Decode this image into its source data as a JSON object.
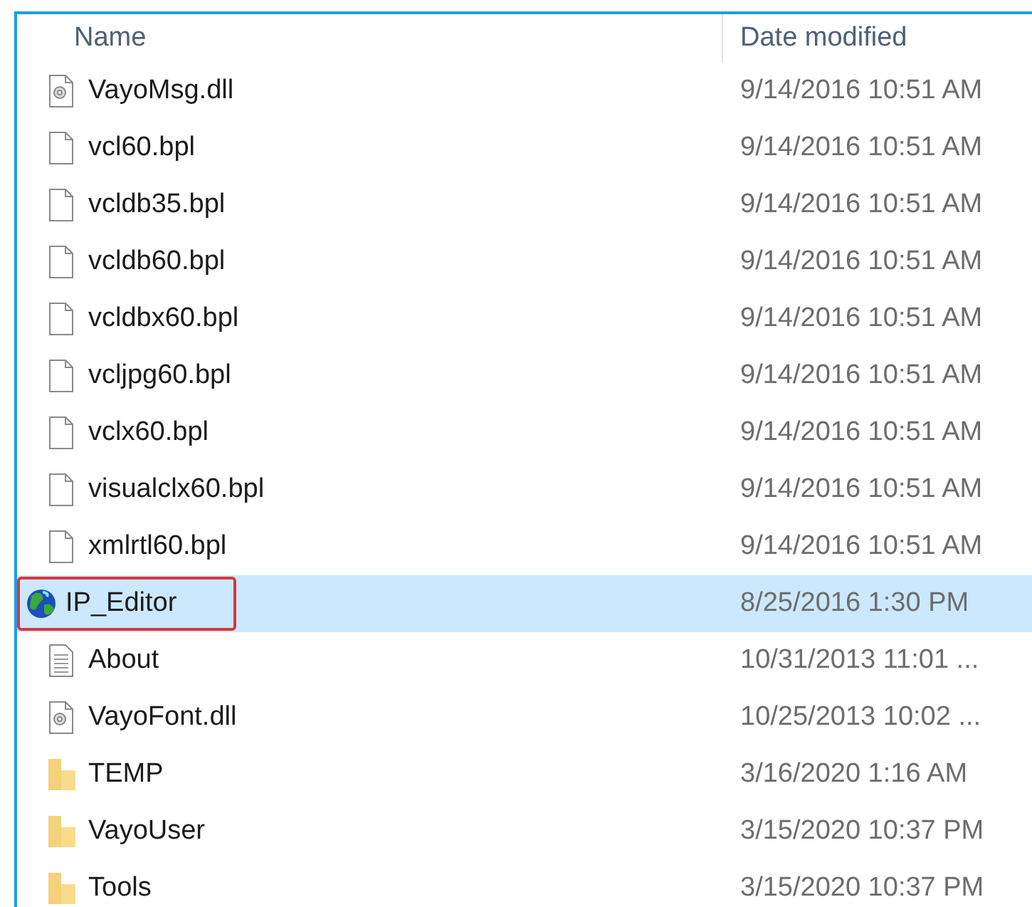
{
  "columns": [
    "Name",
    "Date modified"
  ],
  "files": [
    {
      "kind": "dll",
      "name": "VayoMsg.dll",
      "date": "9/14/2016 10:51 AM",
      "selected": false,
      "outlined": false
    },
    {
      "kind": "file",
      "name": "vcl60.bpl",
      "date": "9/14/2016 10:51 AM",
      "selected": false,
      "outlined": false
    },
    {
      "kind": "file",
      "name": "vcldb35.bpl",
      "date": "9/14/2016 10:51 AM",
      "selected": false,
      "outlined": false
    },
    {
      "kind": "file",
      "name": "vcldb60.bpl",
      "date": "9/14/2016 10:51 AM",
      "selected": false,
      "outlined": false
    },
    {
      "kind": "file",
      "name": "vcldbx60.bpl",
      "date": "9/14/2016 10:51 AM",
      "selected": false,
      "outlined": false
    },
    {
      "kind": "file",
      "name": "vcljpg60.bpl",
      "date": "9/14/2016 10:51 AM",
      "selected": false,
      "outlined": false
    },
    {
      "kind": "file",
      "name": "vclx60.bpl",
      "date": "9/14/2016 10:51 AM",
      "selected": false,
      "outlined": false
    },
    {
      "kind": "file",
      "name": "visualclx60.bpl",
      "date": "9/14/2016 10:51 AM",
      "selected": false,
      "outlined": false
    },
    {
      "kind": "file",
      "name": "xmlrtl60.bpl",
      "date": "9/14/2016 10:51 AM",
      "selected": false,
      "outlined": false
    },
    {
      "kind": "app",
      "name": "IP_Editor",
      "date": "8/25/2016 1:30 PM",
      "selected": true,
      "outlined": true
    },
    {
      "kind": "text",
      "name": "About",
      "date": "10/31/2013 11:01 ...",
      "selected": false,
      "outlined": false
    },
    {
      "kind": "dll",
      "name": "VayoFont.dll",
      "date": "10/25/2013 10:02 ...",
      "selected": false,
      "outlined": false
    },
    {
      "kind": "folder",
      "name": "TEMP",
      "date": "3/16/2020 1:16 AM",
      "selected": false,
      "outlined": false
    },
    {
      "kind": "folder",
      "name": "VayoUser",
      "date": "3/15/2020 10:37 PM",
      "selected": false,
      "outlined": false
    },
    {
      "kind": "folder",
      "name": "Tools",
      "date": "3/15/2020 10:37 PM",
      "selected": false,
      "outlined": false
    }
  ]
}
